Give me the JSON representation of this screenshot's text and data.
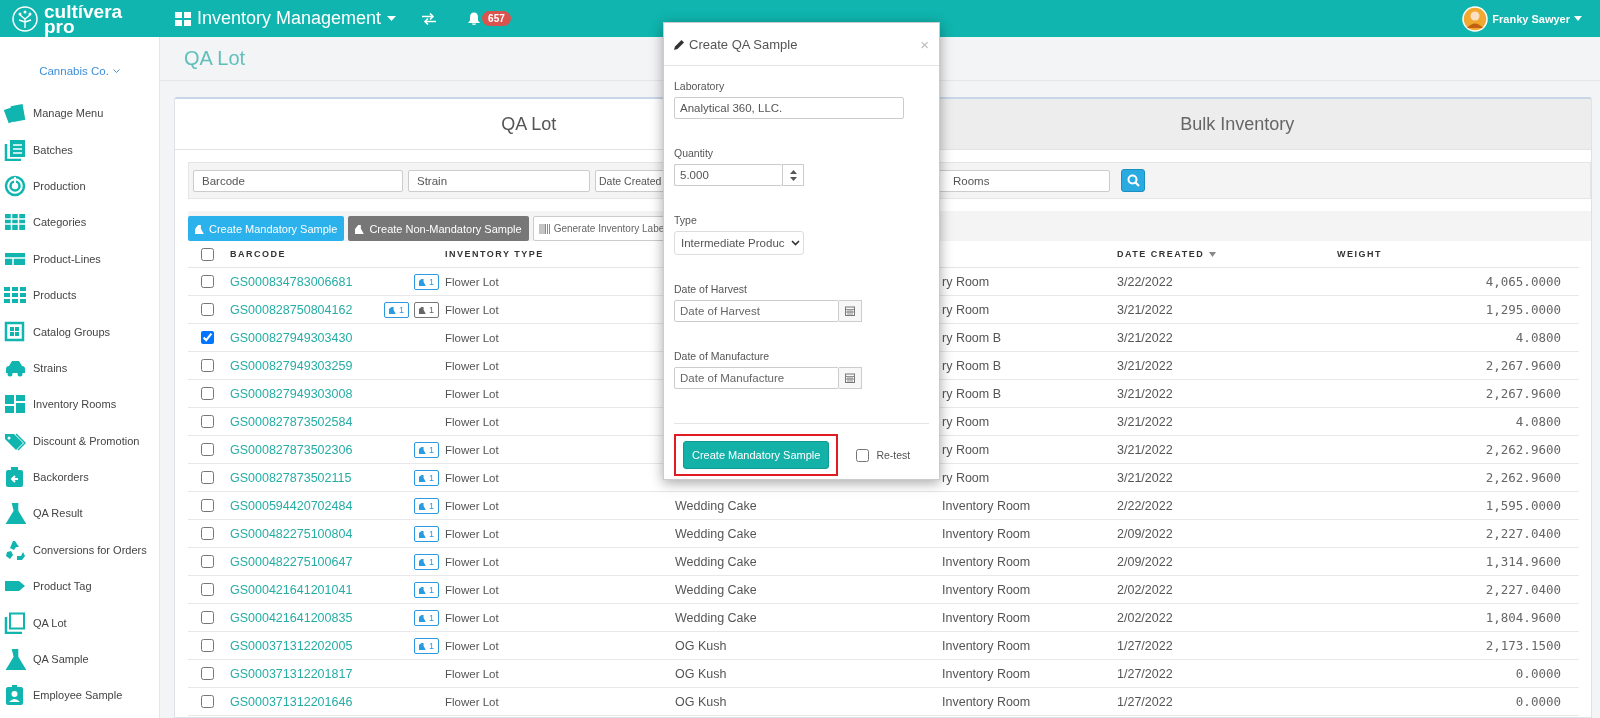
{
  "topbar": {
    "logo": {
      "name": "cultívera",
      "sub": "pro"
    },
    "module": "Inventory Management",
    "notifications": "657",
    "user": "Franky Sawyer"
  },
  "sidebar": {
    "company": "Cannabis Co.",
    "items": [
      {
        "label": "Manage Menu"
      },
      {
        "label": "Batches"
      },
      {
        "label": "Production"
      },
      {
        "label": "Categories"
      },
      {
        "label": "Product-Lines"
      },
      {
        "label": "Products"
      },
      {
        "label": "Catalog Groups"
      },
      {
        "label": "Strains"
      },
      {
        "label": "Inventory Rooms"
      },
      {
        "label": "Discount & Promotion"
      },
      {
        "label": "Backorders"
      },
      {
        "label": "QA Result"
      },
      {
        "label": "Conversions for Orders"
      },
      {
        "label": "Product Tag"
      },
      {
        "label": "QA Lot"
      },
      {
        "label": "QA Sample"
      },
      {
        "label": "Employee Sample"
      }
    ]
  },
  "page_title": "QA Lot",
  "tabs": [
    {
      "label": "QA Lot",
      "selected": true
    },
    {
      "label": "Bulk Inventory",
      "selected": false
    }
  ],
  "filters": [
    {
      "placeholder": "Barcode"
    },
    {
      "placeholder": "Strain"
    },
    {
      "placeholder": "Date Created"
    },
    {
      "placeholder": "Rooms"
    }
  ],
  "actions": [
    {
      "label": "Create Mandatory Sample",
      "kind": "primary"
    },
    {
      "label": "Create Non-Mandatory Sample",
      "kind": "secondary"
    },
    {
      "label": "Generate Inventory Labe",
      "kind": "plain"
    }
  ],
  "table": {
    "select_all": false,
    "columns": [
      {
        "label": "BARCODE",
        "sorted": false
      },
      {
        "label": "INVENTORY TYPE",
        "sorted": false
      },
      {
        "label": "DATE CREATED",
        "sorted": true
      },
      {
        "label": "WEIGHT",
        "sorted": false
      }
    ],
    "rows": [
      {
        "checked": false,
        "barcode": "GS000834783006681",
        "badges": [
          {
            "kind": "mandatory",
            "count": "1"
          }
        ],
        "type": "Flower Lot",
        "room": "ry Room",
        "date": "3/22/2022",
        "weight": "4,065.0000"
      },
      {
        "checked": false,
        "barcode": "GS000828750804162",
        "badges": [
          {
            "kind": "mandatory",
            "count": "1"
          },
          {
            "kind": "non_mandatory",
            "count": "1"
          }
        ],
        "type": "Flower Lot",
        "room": "ry Room",
        "date": "3/21/2022",
        "weight": "1,295.0000"
      },
      {
        "checked": true,
        "barcode": "GS000827949303430",
        "type": "Flower Lot",
        "room": "ry Room B",
        "date": "3/21/2022",
        "weight": "4.0800"
      },
      {
        "checked": false,
        "barcode": "GS000827949303259",
        "type": "Flower Lot",
        "room": "ry Room B",
        "date": "3/21/2022",
        "weight": "2,267.9600"
      },
      {
        "checked": false,
        "barcode": "GS000827949303008",
        "type": "Flower Lot",
        "room": "ry Room B",
        "date": "3/21/2022",
        "weight": "2,267.9600"
      },
      {
        "checked": false,
        "barcode": "GS000827873502584",
        "type": "Flower Lot",
        "room": "ry Room",
        "date": "3/21/2022",
        "weight": "4.0800"
      },
      {
        "checked": false,
        "barcode": "GS000827873502306",
        "badges": [
          {
            "kind": "mandatory",
            "count": "1"
          }
        ],
        "type": "Flower Lot",
        "room": "ry Room",
        "date": "3/21/2022",
        "weight": "2,262.9600"
      },
      {
        "checked": false,
        "barcode": "GS000827873502115",
        "badges": [
          {
            "kind": "mandatory",
            "count": "1"
          }
        ],
        "type": "Flower Lot",
        "room": "ry Room",
        "date": "3/21/2022",
        "weight": "2,262.9600"
      },
      {
        "checked": false,
        "barcode": "GS000594420702484",
        "badges": [
          {
            "kind": "mandatory",
            "count": "1"
          }
        ],
        "type": "Flower Lot",
        "strain": "Wedding Cake",
        "room": "Inventory Room",
        "date": "2/22/2022",
        "weight": "1,595.0000"
      },
      {
        "checked": false,
        "barcode": "GS000482275100804",
        "badges": [
          {
            "kind": "mandatory",
            "count": "1"
          }
        ],
        "type": "Flower Lot",
        "strain": "Wedding Cake",
        "room": "Inventory Room",
        "date": "2/09/2022",
        "weight": "2,227.0400"
      },
      {
        "checked": false,
        "barcode": "GS000482275100647",
        "badges": [
          {
            "kind": "mandatory",
            "count": "1"
          }
        ],
        "type": "Flower Lot",
        "strain": "Wedding Cake",
        "room": "Inventory Room",
        "date": "2/09/2022",
        "weight": "1,314.9600"
      },
      {
        "checked": false,
        "barcode": "GS000421641201041",
        "badges": [
          {
            "kind": "mandatory",
            "count": "1"
          }
        ],
        "type": "Flower Lot",
        "strain": "Wedding Cake",
        "room": "Inventory Room",
        "date": "2/02/2022",
        "weight": "2,227.0400"
      },
      {
        "checked": false,
        "barcode": "GS000421641200835",
        "badges": [
          {
            "kind": "mandatory",
            "count": "1"
          }
        ],
        "type": "Flower Lot",
        "strain": "Wedding Cake",
        "room": "Inventory Room",
        "date": "2/02/2022",
        "weight": "1,804.9600"
      },
      {
        "checked": false,
        "barcode": "GS000371312202005",
        "badges": [
          {
            "kind": "mandatory",
            "count": "1"
          }
        ],
        "type": "Flower Lot",
        "strain": "OG Kush",
        "room": "Inventory Room",
        "date": "1/27/2022",
        "weight": "2,173.1500"
      },
      {
        "checked": false,
        "barcode": "GS000371312201817",
        "type": "Flower Lot",
        "strain": "OG Kush",
        "room": "Inventory Room",
        "date": "1/27/2022",
        "weight": "0.0000"
      },
      {
        "checked": false,
        "barcode": "GS000371312201646",
        "type": "Flower Lot",
        "strain": "OG Kush",
        "room": "Inventory Room",
        "date": "1/27/2022",
        "weight": "0.0000"
      }
    ]
  },
  "modal": {
    "title": "Create QA Sample",
    "close": "×",
    "laboratory": {
      "label": "Laboratory",
      "value": "Analytical 360, LLC."
    },
    "quantity": {
      "label": "Quantity",
      "value": "5.000"
    },
    "type": {
      "label": "Type",
      "value": "Intermediate Produc"
    },
    "harvest": {
      "label": "Date of Harvest",
      "placeholder": "Date of Harvest"
    },
    "manufacture": {
      "label": "Date of Manufacture",
      "placeholder": "Date of Manufacture"
    },
    "submit": {
      "label": "Create Mandatory Sample",
      "highlighted": true
    },
    "retest": {
      "label": "Re-test",
      "checked": false
    }
  }
}
